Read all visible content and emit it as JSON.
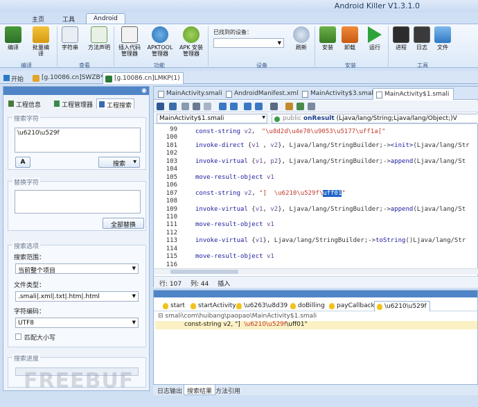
{
  "window": {
    "title": "Android Killer V1.3.1.0"
  },
  "ribbon": {
    "tabs": [
      "主页",
      "工具",
      "Android"
    ],
    "groups": {
      "compile": {
        "label": "编译",
        "buttons": [
          "编译",
          "批量编译"
        ]
      },
      "view": {
        "label": "查看",
        "buttons": [
          "字符串",
          "方法声明"
        ]
      },
      "func": {
        "label": "功能",
        "buttons": [
          "插入代码管理器",
          "APKTOOL管理器",
          "APK 安装管理器"
        ]
      },
      "device": {
        "label": "设备",
        "found_label": "已找到的设备：",
        "refresh": "刷新"
      },
      "install": {
        "label": "安装",
        "buttons": [
          "安装",
          "卸载",
          "运行"
        ]
      },
      "tools": {
        "label": "工具",
        "buttons": [
          "进程",
          "日志",
          "文件"
        ]
      }
    }
  },
  "doc_tabs": [
    "开始",
    "[g.10086.cn]SWZB*",
    "[g.10086.cn]LMKP(1)"
  ],
  "left": {
    "tabs": [
      "工程信息",
      "工程管理器",
      "工程搜索"
    ],
    "search": {
      "title": "搜索字符",
      "value": "\\u6210\\u529f",
      "button": "搜索"
    },
    "replace": {
      "title": "替换字符",
      "button": "全部替换"
    },
    "options": {
      "title": "搜索选项",
      "range_label": "搜索范围：",
      "range_value": "当前整个项目",
      "filetype_label": "文件类型：",
      "filetype_value": ".smali|.xml|.txt|.htm|.html",
      "encoding_label": "字符编码：",
      "encoding_value": "UTF8",
      "case_label": "匹配大小写"
    },
    "progress": {
      "title": "搜索进度"
    }
  },
  "editor": {
    "tabs": [
      "MainActivity.smali",
      "AndroidManifest.xml",
      "MainActivity$3.smali",
      "MainActivity$1.smali"
    ],
    "class_combo": "MainActivity$1.smali",
    "method_combo": {
      "vis": "public",
      "name": "onResult",
      "sig": "(Ljava/lang/String;Ljava/lang/Object;)V"
    },
    "lines": [
      {
        "n": "99",
        "parts": [
          [
            "kw",
            "const-string "
          ],
          [
            "reg",
            "v2"
          ],
          [
            "",
            "， "
          ],
          [
            "st",
            "\"\\u8d2d\\u4e70\\u9053\\u5177\\uff1a[\""
          ]
        ]
      },
      {
        "n": "100",
        "parts": []
      },
      {
        "n": "101",
        "parts": [
          [
            "kw",
            "invoke-direct "
          ],
          [
            "",
            "{"
          ],
          [
            "reg",
            "v1"
          ],
          [
            "",
            " , "
          ],
          [
            "reg",
            "v2"
          ],
          [
            "",
            "}, Ljava/lang/StringBuilder;->"
          ],
          [
            "kw",
            "<init>"
          ],
          [
            "",
            "(Ljava/lang/Str"
          ]
        ]
      },
      {
        "n": "102",
        "parts": []
      },
      {
        "n": "103",
        "parts": [
          [
            "kw",
            "invoke-virtual "
          ],
          [
            "",
            "{"
          ],
          [
            "reg",
            "v1"
          ],
          [
            "",
            ", "
          ],
          [
            "reg",
            "p2"
          ],
          [
            "",
            "}, Ljava/lang/StringBuilder;->"
          ],
          [
            "kw",
            "append"
          ],
          [
            "",
            "(Ljava/lang/St"
          ]
        ]
      },
      {
        "n": "104",
        "parts": []
      },
      {
        "n": "105",
        "parts": [
          [
            "kw",
            "move-result-object "
          ],
          [
            "reg",
            "v1"
          ]
        ]
      },
      {
        "n": "106",
        "parts": []
      },
      {
        "n": "107",
        "parts": [
          [
            "kw",
            "const-string "
          ],
          [
            "reg",
            "v2"
          ],
          [
            "",
            ", "
          ],
          [
            "st",
            "\"]  \\u6210\\u529f\\"
          ],
          [
            "hl",
            "uff01"
          ],
          [
            "st",
            "\""
          ]
        ]
      },
      {
        "n": "108",
        "parts": []
      },
      {
        "n": "109",
        "parts": [
          [
            "kw",
            "invoke-virtual "
          ],
          [
            "",
            "{"
          ],
          [
            "reg",
            "v1"
          ],
          [
            "",
            ", "
          ],
          [
            "reg",
            "v2"
          ],
          [
            "",
            "}, Ljava/lang/StringBuilder;->"
          ],
          [
            "kw",
            "append"
          ],
          [
            "",
            "(Ljava/lang/St"
          ]
        ]
      },
      {
        "n": "110",
        "parts": []
      },
      {
        "n": "111",
        "parts": [
          [
            "kw",
            "move-result-object "
          ],
          [
            "reg",
            "v1"
          ]
        ]
      },
      {
        "n": "112",
        "parts": []
      },
      {
        "n": "113",
        "parts": [
          [
            "kw",
            "invoke-virtual "
          ],
          [
            "",
            "{"
          ],
          [
            "reg",
            "v1"
          ],
          [
            "",
            "}, Ljava/lang/StringBuilder;->"
          ],
          [
            "kw",
            "toString"
          ],
          [
            "",
            "()Ljava/lang/Str"
          ]
        ]
      },
      {
        "n": "114",
        "parts": []
      },
      {
        "n": "115",
        "parts": [
          [
            "kw",
            "move-result-object "
          ],
          [
            "reg",
            "v1"
          ]
        ]
      },
      {
        "n": "116",
        "parts": []
      }
    ],
    "status": {
      "row": "行: 107",
      "col": "列: 44",
      "mode": "插入"
    }
  },
  "results": {
    "tabs": [
      "start",
      "startActivity",
      "\\u6263\\u8d39",
      "doBilling",
      "payCallback",
      "\\u6210\\u529f"
    ],
    "file": "smali\\com\\huibang\\paopao\\MainActivity$1.smali",
    "match": {
      "pre": "const-string v2, \"]  ",
      "hit": "\\u6210\\u529f",
      "post": "\\uff01\""
    }
  },
  "bottom_tabs": [
    "日志输出",
    "搜索结果",
    "方法引用"
  ],
  "watermark": "FREEBUF"
}
